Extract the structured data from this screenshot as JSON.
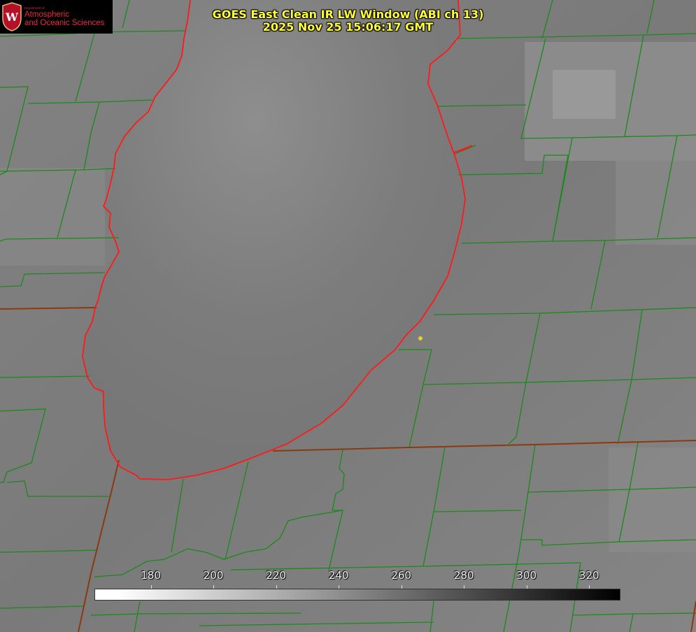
{
  "title": {
    "line1": "GOES East Clean IR LW Window (ABI ch 13)",
    "line2": "2025 Nov 25 15:06:17 GMT"
  },
  "logo": {
    "line_small": "Department of",
    "line1": "Atmospheric",
    "line2": "and Oceanic Sciences"
  },
  "colorbar": {
    "min": 162,
    "max": 330,
    "ticks": [
      180,
      200,
      220,
      240,
      260,
      280,
      300,
      320
    ]
  },
  "colors": {
    "title": "#ffff33",
    "county_lines": "#1a8a1a",
    "state_lines": "#8b3a10",
    "coastline": "#ff1a1a",
    "marker": "#e6d020"
  }
}
